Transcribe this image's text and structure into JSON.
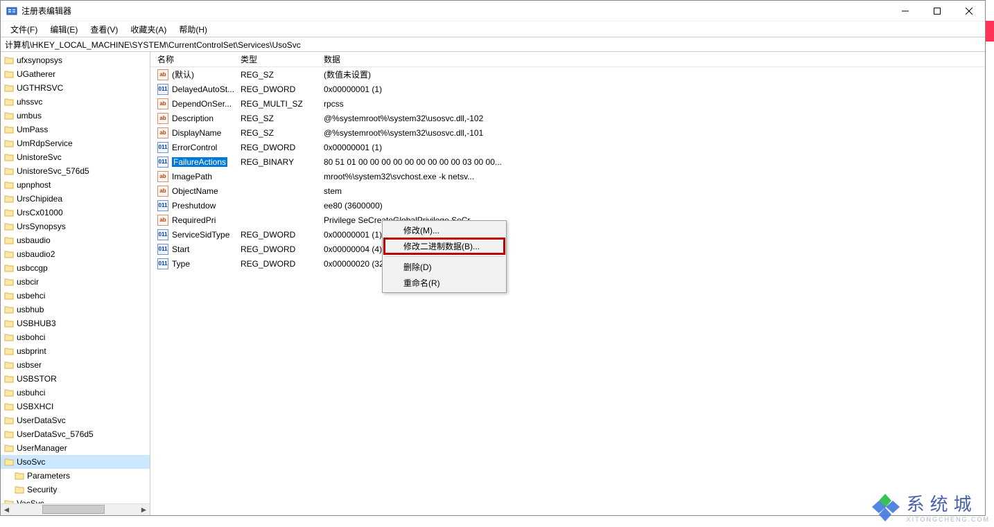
{
  "window": {
    "title": "注册表编辑器"
  },
  "menubar": [
    "文件(F)",
    "编辑(E)",
    "查看(V)",
    "收藏夹(A)",
    "帮助(H)"
  ],
  "address": "计算机\\HKEY_LOCAL_MACHINE\\SYSTEM\\CurrentControlSet\\Services\\UsoSvc",
  "tree": {
    "items": [
      {
        "label": "ufxsynopsys",
        "sub": false
      },
      {
        "label": "UGatherer",
        "sub": false
      },
      {
        "label": "UGTHRSVC",
        "sub": false
      },
      {
        "label": "uhssvc",
        "sub": false
      },
      {
        "label": "umbus",
        "sub": false
      },
      {
        "label": "UmPass",
        "sub": false
      },
      {
        "label": "UmRdpService",
        "sub": false
      },
      {
        "label": "UnistoreSvc",
        "sub": false
      },
      {
        "label": "UnistoreSvc_576d5",
        "sub": false
      },
      {
        "label": "upnphost",
        "sub": false
      },
      {
        "label": "UrsChipidea",
        "sub": false
      },
      {
        "label": "UrsCx01000",
        "sub": false
      },
      {
        "label": "UrsSynopsys",
        "sub": false
      },
      {
        "label": "usbaudio",
        "sub": false
      },
      {
        "label": "usbaudio2",
        "sub": false
      },
      {
        "label": "usbccgp",
        "sub": false
      },
      {
        "label": "usbcir",
        "sub": false
      },
      {
        "label": "usbehci",
        "sub": false
      },
      {
        "label": "usbhub",
        "sub": false
      },
      {
        "label": "USBHUB3",
        "sub": false
      },
      {
        "label": "usbohci",
        "sub": false
      },
      {
        "label": "usbprint",
        "sub": false
      },
      {
        "label": "usbser",
        "sub": false
      },
      {
        "label": "USBSTOR",
        "sub": false
      },
      {
        "label": "usbuhci",
        "sub": false
      },
      {
        "label": "USBXHCI",
        "sub": false
      },
      {
        "label": "UserDataSvc",
        "sub": false
      },
      {
        "label": "UserDataSvc_576d5",
        "sub": false
      },
      {
        "label": "UserManager",
        "sub": false
      },
      {
        "label": "UsoSvc",
        "sub": false,
        "selected": true
      },
      {
        "label": "Parameters",
        "sub": true
      },
      {
        "label": "Security",
        "sub": true
      },
      {
        "label": "VacSvc",
        "sub": false
      }
    ]
  },
  "list": {
    "headers": {
      "name": "名称",
      "type": "类型",
      "data": "数据"
    },
    "rows": [
      {
        "icon": "string",
        "name": "(默认)",
        "type": "REG_SZ",
        "data": "(数值未设置)"
      },
      {
        "icon": "binary",
        "name": "DelayedAutoSt...",
        "type": "REG_DWORD",
        "data": "0x00000001 (1)"
      },
      {
        "icon": "string",
        "name": "DependOnSer...",
        "type": "REG_MULTI_SZ",
        "data": "rpcss"
      },
      {
        "icon": "string",
        "name": "Description",
        "type": "REG_SZ",
        "data": "@%systemroot%\\system32\\usosvc.dll,-102"
      },
      {
        "icon": "string",
        "name": "DisplayName",
        "type": "REG_SZ",
        "data": "@%systemroot%\\system32\\usosvc.dll,-101"
      },
      {
        "icon": "binary",
        "name": "ErrorControl",
        "type": "REG_DWORD",
        "data": "0x00000001 (1)"
      },
      {
        "icon": "binary",
        "name": "FailureActions",
        "type": "REG_BINARY",
        "data": "80 51 01 00 00 00 00 00 00 00 00 00 03 00 00...",
        "selected": true
      },
      {
        "icon": "string",
        "name": "ImagePath",
        "type": "",
        "data": "mroot%\\system32\\svchost.exe -k netsv..."
      },
      {
        "icon": "string",
        "name": "ObjectName",
        "type": "",
        "data": "stem"
      },
      {
        "icon": "binary",
        "name": "Preshutdow",
        "type": "",
        "data": "ee80 (3600000)"
      },
      {
        "icon": "string",
        "name": "RequiredPri",
        "type": "",
        "data": "Privilege SeCreateGlobalPrivilege SeCr..."
      },
      {
        "icon": "binary",
        "name": "ServiceSidType",
        "type": "REG_DWORD",
        "data": "0x00000001 (1)"
      },
      {
        "icon": "binary",
        "name": "Start",
        "type": "REG_DWORD",
        "data": "0x00000004 (4)"
      },
      {
        "icon": "binary",
        "name": "Type",
        "type": "REG_DWORD",
        "data": "0x00000020 (32)"
      }
    ]
  },
  "context_menu": {
    "items": [
      {
        "label": "修改(M)...",
        "highlight": false
      },
      {
        "label": "修改二进制数据(B)...",
        "highlight": true
      },
      {
        "sep": true
      },
      {
        "label": "删除(D)",
        "highlight": false
      },
      {
        "label": "重命名(R)",
        "highlight": false
      }
    ]
  },
  "watermark": {
    "line1": "系统城",
    "line2": "XITONGCHENG.COM"
  }
}
